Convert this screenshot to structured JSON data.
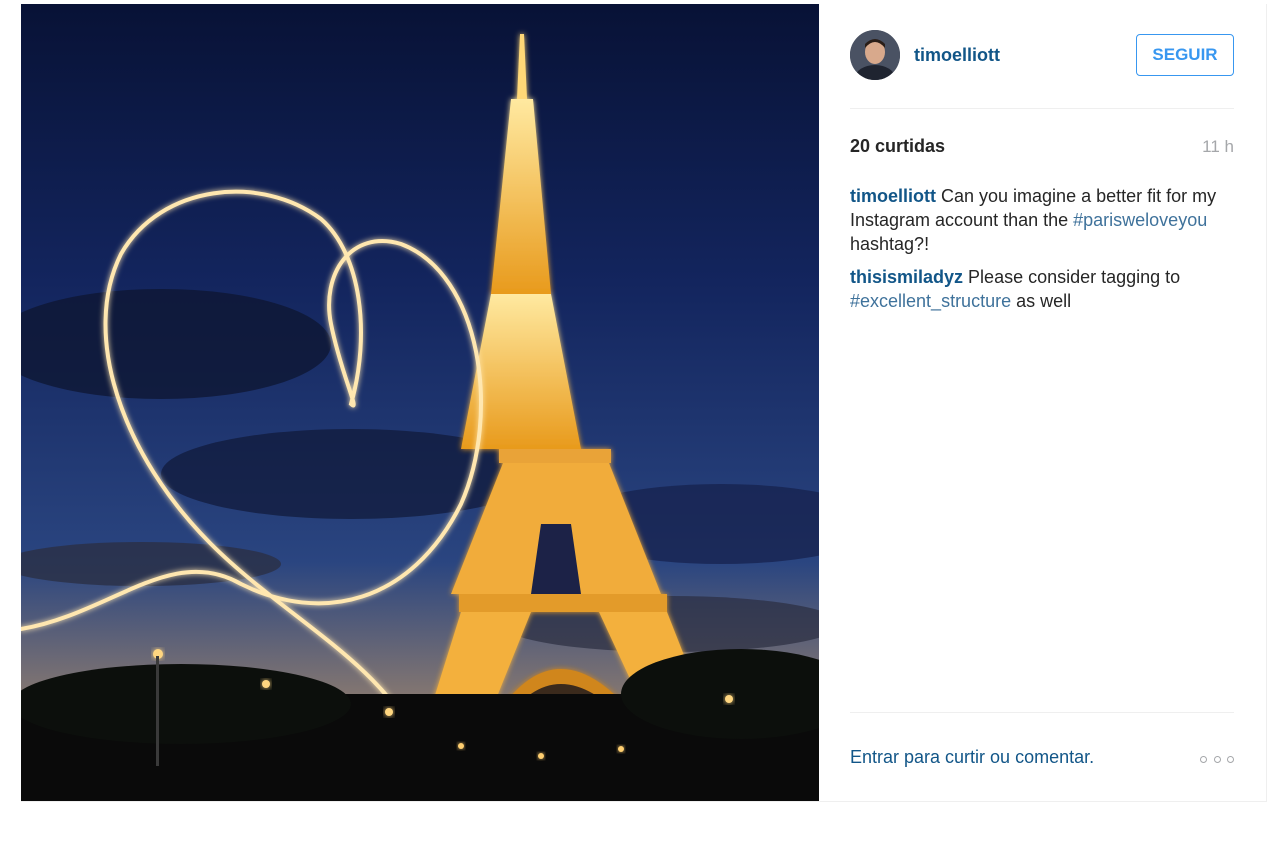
{
  "post": {
    "author": {
      "username": "timoelliott"
    },
    "follow_label": "SEGUIR",
    "likes": "20 curtidas",
    "time_ago": "11 h",
    "comments": [
      {
        "username": "timoelliott",
        "text_before": " Can you imagine a better fit for my Instagram account than the ",
        "hashtag": "#parisweloveyou",
        "text_after": " hashtag?!"
      },
      {
        "username": "thisismiladyz",
        "text_before": " Please consider tagging to ",
        "hashtag": "#excellent_structure",
        "text_after": " as well"
      }
    ],
    "footer_link": "Entrar para curtir ou comentar.",
    "more_icon": "ellipsis-icon"
  },
  "colors": {
    "link": "#125688",
    "hashtag": "#3f729b",
    "follow_blue": "#3897f0",
    "muted": "#a5a7aa"
  }
}
